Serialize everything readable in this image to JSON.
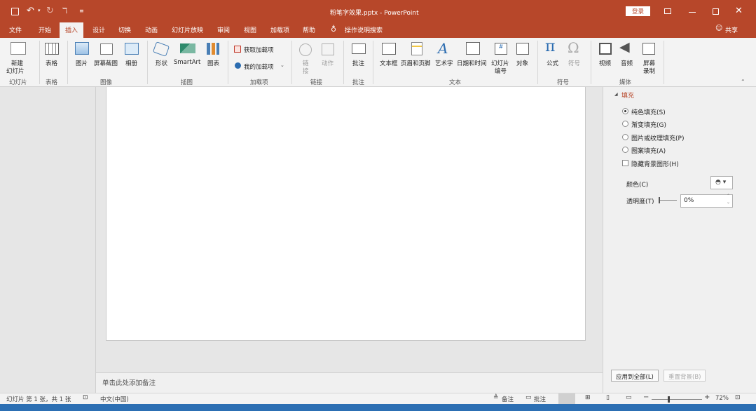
{
  "window": {
    "title": "粉笔字效果.pptx  -  PowerPoint",
    "login": "登录"
  },
  "tabs": [
    "文件",
    "开始",
    "插入",
    "设计",
    "切换",
    "动画",
    "幻灯片放映",
    "审阅",
    "视图",
    "加载项",
    "帮助",
    "操作说明搜索"
  ],
  "share": "共享",
  "ribbon": {
    "new_slide": "新建\n幻灯片",
    "groups": {
      "slides": "幻灯片",
      "tables": "表格",
      "images": "图像",
      "illustrations": "插图",
      "addins": "加载项",
      "links": "链接",
      "comments": "批注",
      "text": "文本",
      "symbols": "符号",
      "media": "媒体"
    },
    "buttons": {
      "new_slide_l1": "新建",
      "new_slide_l2": "幻灯片",
      "table": "表格",
      "picture": "图片",
      "screenshot": "屏幕截图",
      "album": "相册",
      "shapes": "形状",
      "smartart": "SmartArt",
      "chart": "图表",
      "get_addins": "获取加载项",
      "my_addins": "我的加载项",
      "link_l1": "链",
      "link_l2": "接",
      "action": "动作",
      "comment": "批注",
      "textbox": "文本框",
      "header_footer": "页眉和页脚",
      "wordart": "艺术字",
      "datetime": "日期和时间",
      "slidenum_l1": "幻灯片",
      "slidenum_l2": "编号",
      "object": "对象",
      "equation": "公式",
      "symbol": "符号",
      "video": "视频",
      "audio": "音频",
      "screenrec_l1": "屏幕",
      "screenrec_l2": "录制"
    }
  },
  "notes_placeholder": "单击此处添加备注",
  "format_pane": {
    "section": "填充",
    "options": [
      "纯色填充(S)",
      "渐变填充(G)",
      "图片或纹理填充(P)",
      "图案填充(A)"
    ],
    "hide_bg": "隐藏背景图形(H)",
    "color_label": "颜色(C)",
    "transparency_label": "透明度(T)",
    "transparency_value": "0%",
    "apply_all": "应用到全部(L)",
    "reset_bg": "重置背景(B)"
  },
  "status": {
    "slide_info": "幻灯片 第 1 张，共 1 张",
    "language": "中文(中国)",
    "notes": "备注",
    "comments": "批注",
    "zoom": "72%"
  }
}
